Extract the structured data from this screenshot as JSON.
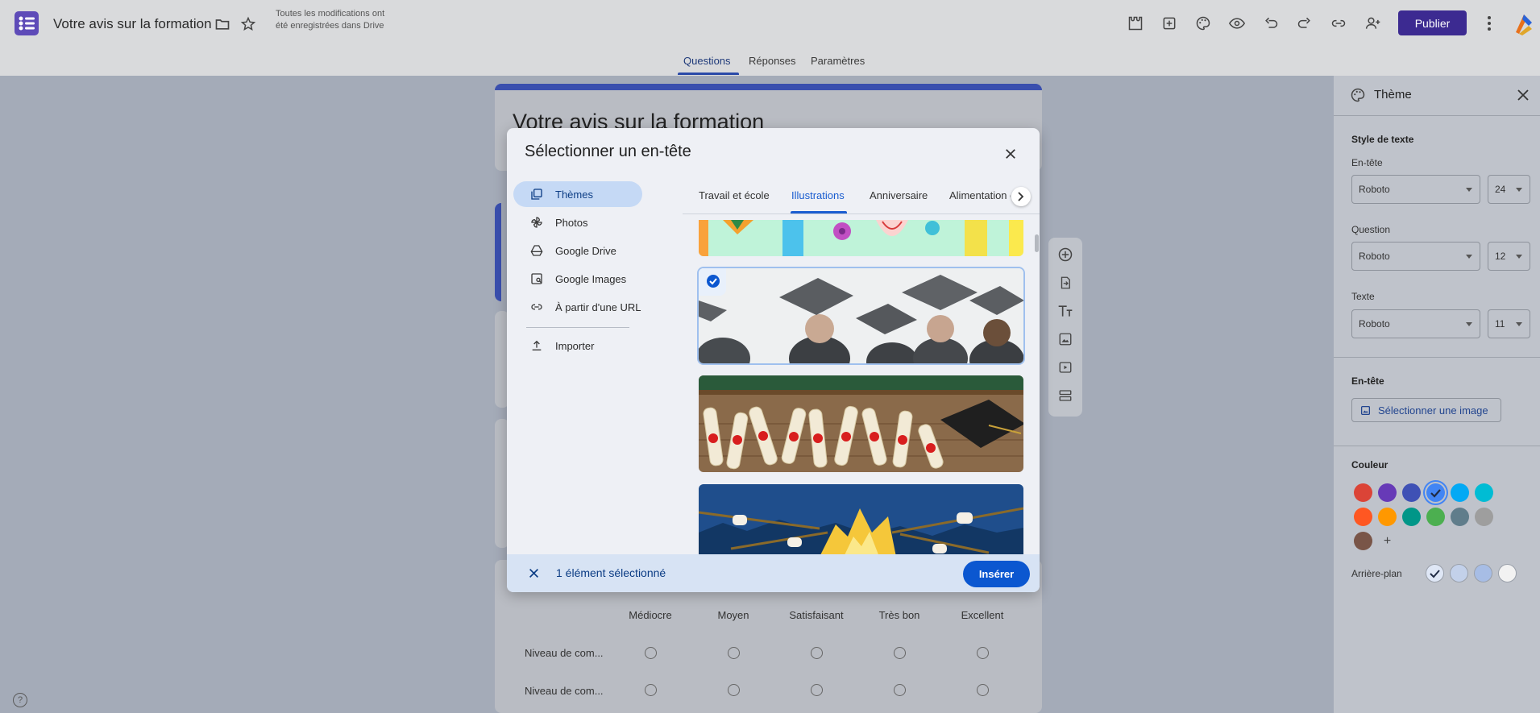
{
  "app": {
    "doc_title": "Votre avis sur la formation",
    "save_status": "Toutes les modifications ont été enregistrées dans Drive",
    "publish_label": "Publier"
  },
  "tabs": {
    "questions": "Questions",
    "responses": "Réponses",
    "settings": "Paramètres"
  },
  "form": {
    "title": "Votre avis sur la formation",
    "grid_columns": [
      "Médiocre",
      "Moyen",
      "Satisfaisant",
      "Très bon",
      "Excellent"
    ],
    "grid_rows": [
      "Niveau de com...",
      "Niveau de com..."
    ]
  },
  "dialog": {
    "title": "Sélectionner un en-tête",
    "nav": [
      {
        "label": "Thèmes",
        "icon": "themes-icon"
      },
      {
        "label": "Photos",
        "icon": "photos-icon"
      },
      {
        "label": "Google Drive",
        "icon": "drive-icon"
      },
      {
        "label": "Google Images",
        "icon": "image-search-icon"
      },
      {
        "label": "À partir d'une URL",
        "icon": "link-icon"
      },
      {
        "label": "Importer",
        "icon": "upload-icon"
      }
    ],
    "categories": [
      "Travail et école",
      "Illustrations",
      "Anniversaire",
      "Alimentation et boissons"
    ],
    "active_category": "Illustrations",
    "selected_count_text": "1 élément sélectionné",
    "insert_label": "Insérer"
  },
  "theme_panel": {
    "title": "Thème",
    "text_style_label": "Style de texte",
    "header": {
      "label": "En-tête",
      "font": "Roboto",
      "size": "24"
    },
    "question": {
      "label": "Question",
      "font": "Roboto",
      "size": "12"
    },
    "text": {
      "label": "Texte",
      "font": "Roboto",
      "size": "11"
    },
    "header_section_label": "En-tête",
    "select_image_label": "Sélectionner une image",
    "color_label": "Couleur",
    "colors": [
      "#db4437",
      "#673ab7",
      "#3f51b5",
      "#4285f4",
      "#03a9f4",
      "#00bcd4",
      "#ff5722",
      "#ff9800",
      "#009688",
      "#4caf50",
      "#607d8b",
      "#9e9e9e",
      "#795548"
    ],
    "selected_color": "#4285f4",
    "background_label": "Arrière-plan",
    "backgrounds": [
      "#dfe7f6",
      "#c3d1ea",
      "#a7bde5",
      "#f2f2f2"
    ]
  }
}
